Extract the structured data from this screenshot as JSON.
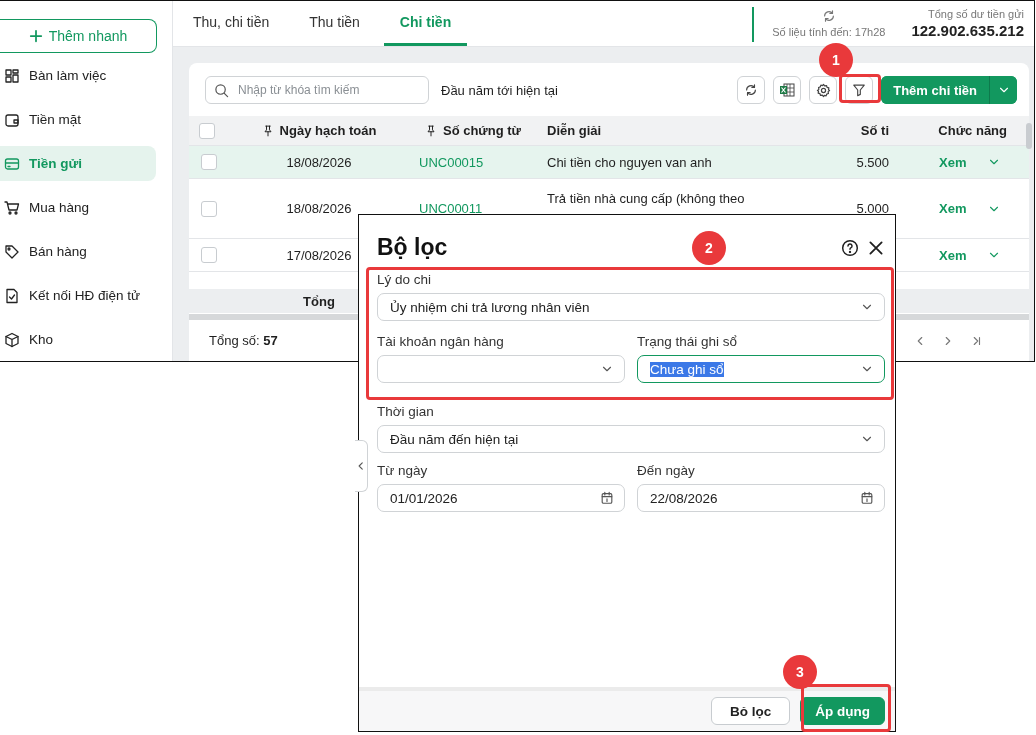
{
  "sidebar": {
    "quick_add": "Thêm nhanh",
    "items": [
      {
        "label": "Bàn làm việc",
        "selected": false
      },
      {
        "label": "Tiền mặt",
        "selected": false
      },
      {
        "label": "Tiền gửi",
        "selected": true
      },
      {
        "label": "Mua hàng",
        "selected": false
      },
      {
        "label": "Bán hàng",
        "selected": false
      },
      {
        "label": "Kết nối HĐ điện tử",
        "selected": false
      },
      {
        "label": "Kho",
        "selected": false
      }
    ]
  },
  "tabs": [
    {
      "label": "Thu, chi tiền",
      "selected": false
    },
    {
      "label": "Thu tiền",
      "selected": false
    },
    {
      "label": "Chi tiền",
      "selected": true
    }
  ],
  "sync": {
    "label": "Số liệu tính đến: 17h28"
  },
  "balance": {
    "label": "Tổng số dư tiền gửi",
    "value": "122.902.635.212"
  },
  "toolbar": {
    "search_placeholder": "Nhập từ khóa tìm kiếm",
    "period": "Đầu năm tới hiện tại",
    "add_button": "Thêm chi tiền"
  },
  "table": {
    "columns": [
      "Ngày hạch toán",
      "Số chứng từ",
      "Diễn giải",
      "Số ti",
      "Chức năng"
    ],
    "rows": [
      {
        "date": "18/08/2026",
        "voucher": "UNC00015",
        "description": "Chi tiền cho nguyen van anh",
        "amount": "5.500",
        "action": "Xem",
        "selected": true,
        "checked": false
      },
      {
        "date": "18/08/2026",
        "voucher": "UNC00011",
        "description": "Trả tiền nhà cung cấp (không theo",
        "amount": "5.000",
        "action": "Xem",
        "selected": false,
        "checked": false
      },
      {
        "date": "17/08/2026",
        "action": "Xem",
        "selected": false,
        "checked": false
      }
    ],
    "total_label": "Tổng",
    "all_checked": false
  },
  "footer": {
    "total_label": "Tổng số:",
    "total": "57"
  },
  "filter_dialog": {
    "title": "Bộ lọc",
    "rows": [
      [
        {
          "label": "Lý do chi",
          "value": "Ủy nhiệm chi trả lương nhân viên",
          "kind": "select",
          "focused": false
        }
      ],
      [
        {
          "label": "Tài khoản ngân hàng",
          "kind": "select",
          "focused": false
        },
        {
          "label": "Trạng thái ghi sổ",
          "value": "Chưa ghi sổ",
          "kind": "select",
          "focused": true
        }
      ],
      [
        {
          "label": "Thời gian",
          "value": "Đầu năm đến hiện tại",
          "kind": "select",
          "focused": false
        }
      ],
      [
        {
          "label": "Từ ngày",
          "value": "01/01/2026",
          "kind": "date",
          "focused": false
        },
        {
          "label": "Đến ngày",
          "value": "22/08/2026",
          "kind": "date",
          "focused": false
        }
      ]
    ],
    "buttons": [
      {
        "label": "Bỏ lọc",
        "kind": "secondary"
      },
      {
        "label": "Áp dụng",
        "kind": "primary"
      }
    ]
  },
  "annotations": [
    {
      "label": "1"
    },
    {
      "label": "2"
    },
    {
      "label": "3"
    }
  ]
}
